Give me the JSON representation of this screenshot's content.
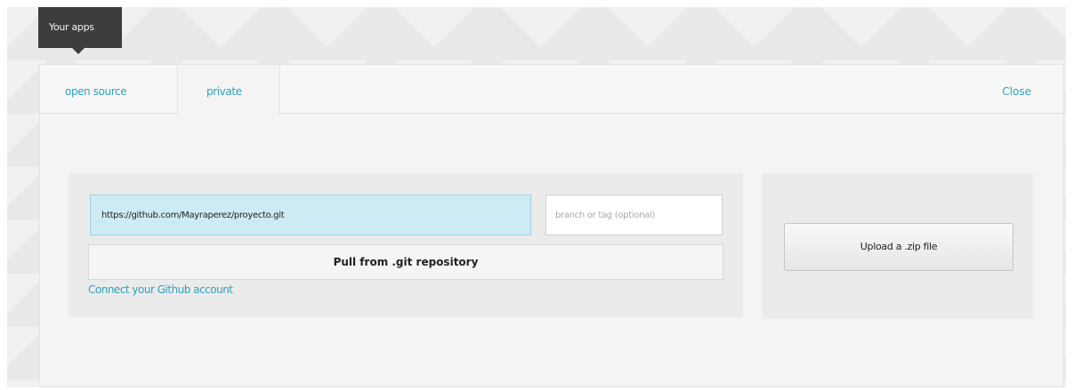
{
  "tooltip": {
    "label": "Your apps"
  },
  "tabs": [
    {
      "label": "open source"
    },
    {
      "label": "private"
    }
  ],
  "close_label": "Close",
  "git": {
    "repo_value": "https://github.com/Mayraperez/proyecto.git",
    "branch_placeholder": "branch or tag (optional)",
    "pull_label": "Pull from .git repository",
    "connect_label": "Connect your Github account"
  },
  "upload": {
    "label": "Upload a .zip file"
  },
  "colors": {
    "accent": "#2fa0bb",
    "input_highlight": "#cdebf4",
    "tooltip_bg": "#3d3d3d"
  }
}
